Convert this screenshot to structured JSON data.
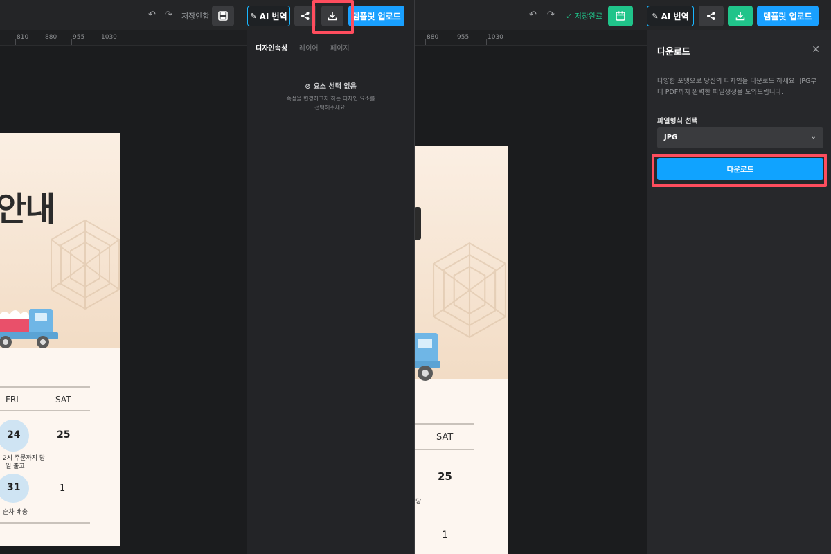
{
  "left": {
    "toolbar": {
      "undo_icon": "undo-icon",
      "redo_icon": "redo-icon",
      "save_status": "저장안함",
      "save_icon": "floppy-disk-icon",
      "ai_translate_label": "AI 번역",
      "share_icon": "share-icon",
      "download_icon": "download-icon",
      "template_upload_label": "템플릿 업로드"
    },
    "ruler": [
      "810",
      "880",
      "955",
      "1030"
    ],
    "panel": {
      "tabs": [
        "디자인속성",
        "레이어",
        "페이지"
      ],
      "empty_title": "요소 선택 없음",
      "empty_desc_line1": "속성을 변경하고자 하는 디자인 요소를",
      "empty_desc_line2": "선택해주세요."
    },
    "card": {
      "title_fragment": "안내",
      "days": [
        "FRI",
        "SAT"
      ],
      "dates_row1": [
        "24",
        "25"
      ],
      "note_row1_line1": "2시 주문까지 당",
      "note_row1_line2": "일 출고",
      "dates_row2": [
        "31",
        "1"
      ],
      "note_row2": "순차 배송"
    }
  },
  "right": {
    "toolbar": {
      "undo_icon": "undo-icon",
      "redo_icon": "redo-icon",
      "save_status": "저장완료",
      "save_icon": "calendar-save-icon",
      "ai_translate_label": "AI 번역",
      "share_icon": "share-icon",
      "download_icon": "download-icon",
      "template_upload_label": "템플릿 업로드"
    },
    "ruler": [
      "880",
      "955",
      "1030"
    ],
    "card": {
      "day": "SAT",
      "date1": "25",
      "date2": "1",
      "note_fragment": "당"
    },
    "download_panel": {
      "title": "다운로드",
      "close_icon": "close-icon",
      "description_line1": "다양한 포맷으로 당신의 디자인을 다운로드 하세요! JPG부",
      "description_line2": "터 PDF까지 완벽한 파일생성을 도와드립니다.",
      "format_label": "파일형식 선택",
      "format_value": "JPG",
      "download_button": "다운로드"
    }
  },
  "colors": {
    "accent_blue": "#19a0ff",
    "ai_border": "#19b6ff",
    "success_green": "#20c48a",
    "highlight_red": "#ff4d5e"
  }
}
